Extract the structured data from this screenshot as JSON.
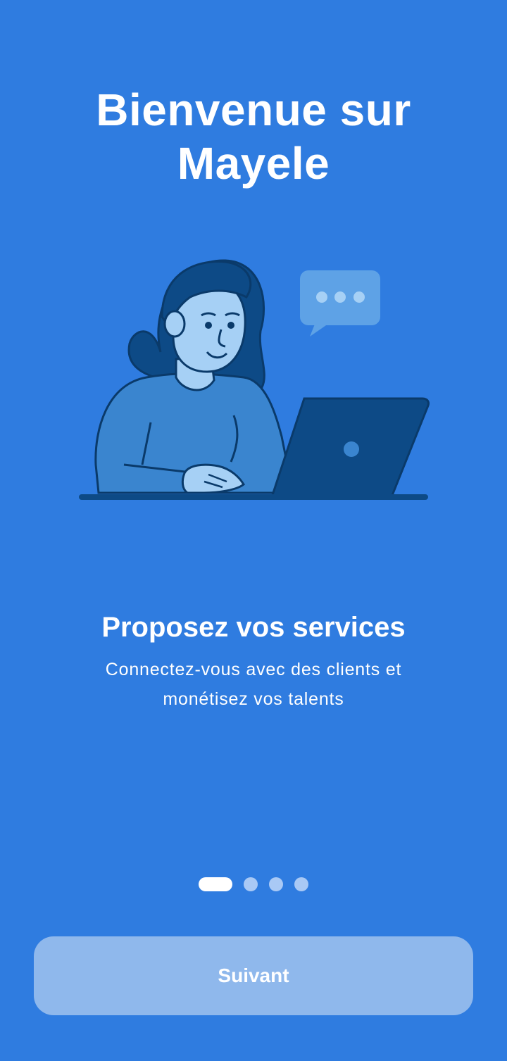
{
  "onboarding": {
    "title_line1": "Bienvenue sur",
    "title_line2": "Mayele",
    "headline": "Proposez vos services",
    "description": "Connectez-vous avec des clients et monétisez vos talents",
    "next_button_label": "Suivant",
    "pager": {
      "total_pages": 4,
      "current_page": 1
    }
  },
  "colors": {
    "background": "#2f7ce0",
    "button_background": "#8fb8ec",
    "dot_active": "#ffffff",
    "dot_inactive": "#a9c9f5",
    "illustration_dark": "#0d4a86",
    "illustration_light": "#a6d0f5"
  },
  "icons": {
    "illustration": "woman-at-laptop-illustration",
    "chat": "chat-bubble-icon"
  }
}
